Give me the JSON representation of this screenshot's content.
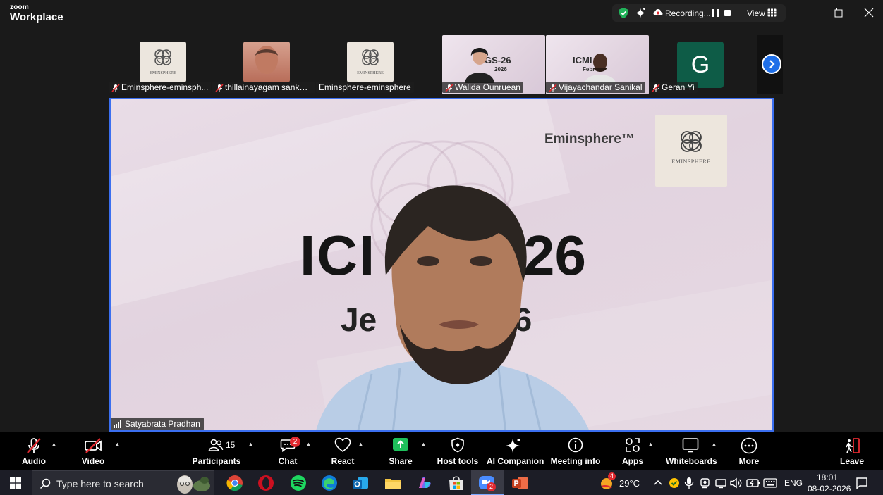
{
  "app": {
    "brand_small": "zoom",
    "brand_big": "Workplace"
  },
  "titlebar": {
    "recording_label": "Recording...",
    "view_label": "View"
  },
  "strip": {
    "participants": [
      {
        "name": "Eminsphere-eminsph..."
      },
      {
        "name": "thillainayagam sankar..."
      },
      {
        "name": "Eminsphere-eminsphere"
      },
      {
        "name": "Walida Ounruean",
        "slide_text": "GS-26",
        "slide_sub": "2026"
      },
      {
        "name": "Vijayachandar Sanikal",
        "slide_text": "ICMI  26",
        "slide_sub": "Febr"
      },
      {
        "name": "Geran Yi",
        "initial": "G"
      }
    ],
    "logo_word": "EMINSPHERE"
  },
  "speaker": {
    "name": "Satyabrata Pradhan",
    "slide_brand": "Eminsphere™",
    "slide_logo_word": "EMINSPHERE",
    "slide_title_left": "ICI",
    "slide_title_right": "26",
    "slide_sub_left": "Je",
    "slide_sub_right": "26"
  },
  "toolbar": {
    "audio": "Audio",
    "video": "Video",
    "participants": "Participants",
    "participants_count": "15",
    "chat": "Chat",
    "chat_badge": "2",
    "react": "React",
    "share": "Share",
    "host_tools": "Host tools",
    "ai_companion": "AI Companion",
    "meeting_info": "Meeting info",
    "apps": "Apps",
    "whiteboards": "Whiteboards",
    "more": "More",
    "leave": "Leave"
  },
  "taskbar": {
    "search_placeholder": "Type here to search",
    "zoom_badge": "2",
    "weather": "29°C",
    "weather_badge": "4",
    "language": "ENG",
    "time": "18:01",
    "date": "08-02-2026"
  },
  "colors": {
    "accent": "#3b6ff0",
    "share_green": "#1ec05b",
    "mute_red": "#e0292f"
  }
}
